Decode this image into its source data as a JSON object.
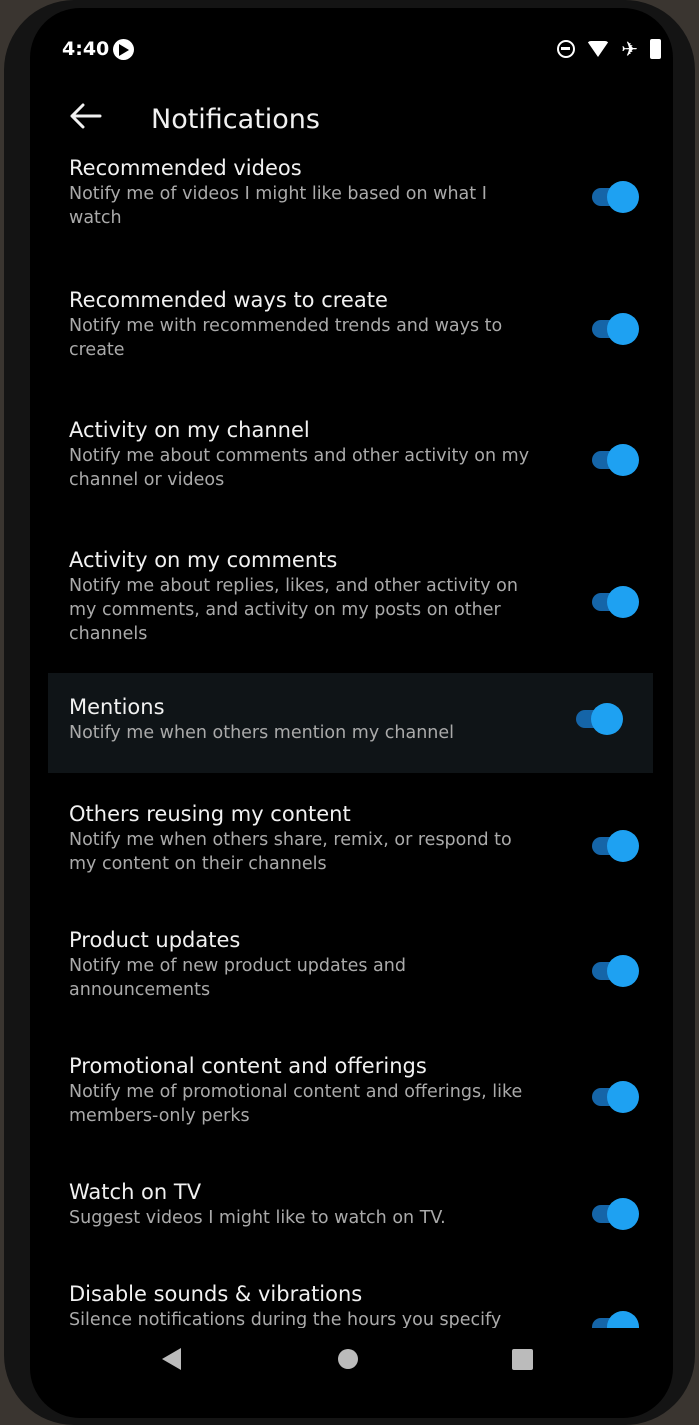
{
  "status_bar": {
    "time": "4:40",
    "icons": [
      "cast-icon",
      "do-not-disturb-icon",
      "wifi-icon",
      "airplane-icon",
      "battery-icon"
    ]
  },
  "app_bar": {
    "back_icon": "back-arrow-icon",
    "title": "Notifications"
  },
  "colors": {
    "background": "#000000",
    "switch_thumb": "#1ea1f2",
    "switch_track": "#1565a8",
    "title_text": "#f1f1f1",
    "subtitle_text": "#aaaaaa"
  },
  "settings": [
    {
      "title": "Recommended videos",
      "subtitle": "Notify me of videos I might like based on what I watch",
      "enabled": true
    },
    {
      "title": "Recommended ways to create",
      "subtitle": "Notify me with recommended trends and ways to create",
      "enabled": true
    },
    {
      "title": "Activity on my channel",
      "subtitle": "Notify me about comments and other activity on my channel or videos",
      "enabled": true
    },
    {
      "title": "Activity on my comments",
      "subtitle": "Notify me about replies, likes, and other activity on my comments, and activity on my posts on other channels",
      "enabled": true
    },
    {
      "title": "Mentions",
      "subtitle": "Notify me when others mention my channel",
      "enabled": true
    },
    {
      "title": "Others reusing my content",
      "subtitle": "Notify me when others share, remix, or respond to my content on their channels",
      "enabled": true
    },
    {
      "title": "Product updates",
      "subtitle": "Notify me of new product updates and announcements",
      "enabled": true
    },
    {
      "title": "Promotional content and offerings",
      "subtitle": "Notify me of promotional content and offerings, like members-only perks",
      "enabled": true
    },
    {
      "title": "Watch on TV",
      "subtitle": "Suggest videos I might like to watch on TV.",
      "enabled": true
    },
    {
      "title": "Disable sounds & vibrations",
      "subtitle": "Silence notifications during the hours you specify",
      "enabled": true
    }
  ],
  "nav_bar": {
    "icons": [
      "nav-back-icon",
      "nav-home-icon",
      "nav-recents-icon"
    ]
  }
}
